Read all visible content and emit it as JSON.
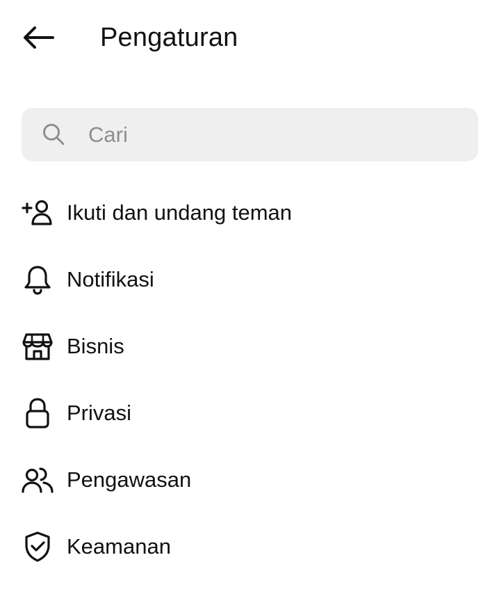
{
  "header": {
    "title": "Pengaturan",
    "back_icon": "arrow-left-icon"
  },
  "search": {
    "placeholder": "Cari",
    "value": "",
    "icon": "search-icon"
  },
  "menu": [
    {
      "label": "Ikuti dan undang teman",
      "icon": "add-person-icon"
    },
    {
      "label": "Notifikasi",
      "icon": "bell-icon"
    },
    {
      "label": "Bisnis",
      "icon": "shop-icon"
    },
    {
      "label": "Privasi",
      "icon": "lock-icon"
    },
    {
      "label": "Pengawasan",
      "icon": "people-icon"
    },
    {
      "label": "Keamanan",
      "icon": "shield-check-icon"
    }
  ],
  "colors": {
    "background": "#ffffff",
    "text": "#111111",
    "search_background": "#efefef",
    "placeholder": "#8e8e8e"
  }
}
